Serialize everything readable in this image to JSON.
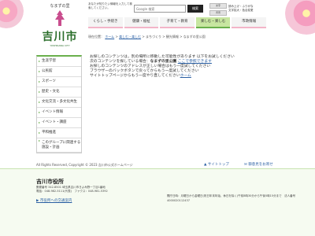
{
  "header": {
    "logo_sub": "なまずの里",
    "logo_main": "吉川市",
    "logo_en": "YOSHIKAWA CITY",
    "notice": "あなたが知りたい情報を入力して検索してください。",
    "search_placeholder": "Google 検索",
    "search_button": "検索",
    "mini_buttons": [
      "文字",
      "背景"
    ],
    "util_links": [
      "読み上げ・ふりがな",
      "文字拡大・色合変更"
    ]
  },
  "nav": {
    "items": [
      "くらし・手続き",
      "健康・福祉",
      "子育て・教育",
      "楽しむ・楽しむ",
      "市政情報"
    ]
  },
  "breadcrumb": {
    "prefix": "現在位置：",
    "items": [
      "ホーム",
      "楽しむ・楽しむ",
      "まちづくり",
      "観光情報"
    ],
    "current": "なまずの里公園"
  },
  "sidebar": {
    "items": [
      "生涯学習",
      "公民館",
      "スポーツ",
      "歴史・文化",
      "文化交流・多文化共生",
      "イベント情報",
      "イベント・講座",
      "平和推進",
      "このグループに関連する施設・計画"
    ]
  },
  "main": {
    "line1": "お探しのコンテンツは，別の場所に移動した可能性があります 以下をお試しください",
    "line2_a": "次のコンテンツを探している場合：",
    "line2_b": "なまずの里公園",
    "line2_link": "ここで参照できます",
    "line3": "お探しのコンテンツのアドレスが正しい場合はもう一度試してください",
    "line4": "ブラウザーのバックボタンで戻ってからもう一度試してください",
    "line5_a": "サイトトップページからもう一度やり直してください",
    "line5_link": "ホーム"
  },
  "footer": {
    "copyright": "All Rights Reserved, Copyright © 2023 吉川市公式ホームページ",
    "pagetop": "サイトトップ",
    "contact": "御意見をお寄せ",
    "org_name": "吉川市役所",
    "address": "郵便番号 342-8501 埼玉県吉川市きよみ野一丁目1番地",
    "tel": "電話：048-982-5111(代表)　ファクス：048-981-5392",
    "access_link": "市役所への交通案内",
    "hours": "開庁日時：月曜日から金曜日(祝日年末年始、休日を除く)午前8時30分から午後5時15分まで　法人番号4000020112437"
  },
  "colors": {
    "accent_green": "#6ab04c",
    "accent_pink": "#f3b5c8",
    "link_blue": "#2a5fa3"
  }
}
